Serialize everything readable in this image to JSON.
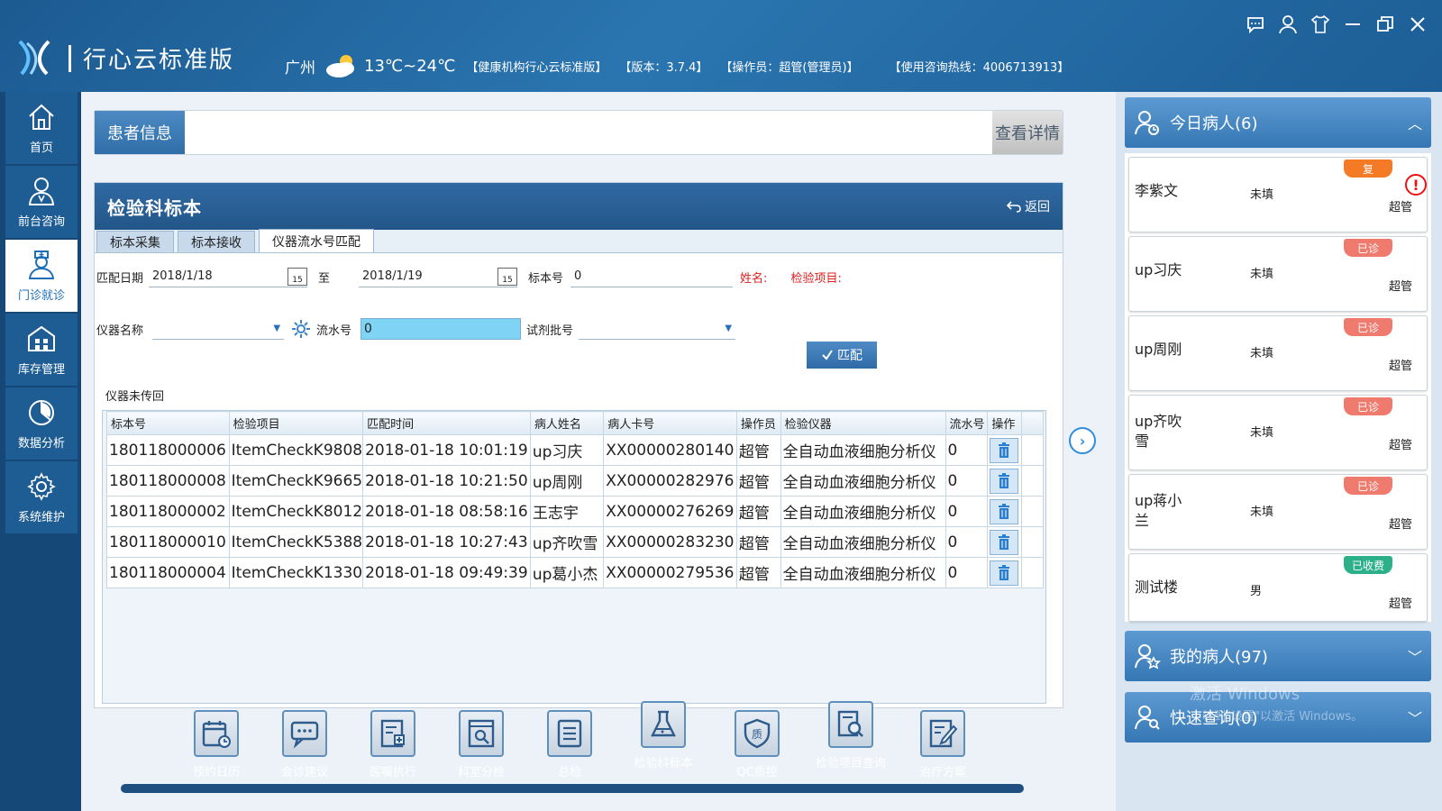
{
  "header": {
    "app_title": "行心云标准版",
    "city": "广州",
    "temperature": "13℃~24℃",
    "org": "【健康机构行心云标准版】",
    "version": "【版本：3.7.4】",
    "operator": "【操作员：超管(管理员)】",
    "hotline": "【使用咨询热线：4006713913】"
  },
  "sidebar": {
    "items": [
      {
        "label": "首页",
        "icon": "home-icon"
      },
      {
        "label": "前台咨询",
        "icon": "consult-icon"
      },
      {
        "label": "门诊就诊",
        "icon": "doctor-icon"
      },
      {
        "label": "库存管理",
        "icon": "warehouse-icon"
      },
      {
        "label": "数据分析",
        "icon": "chart-icon"
      },
      {
        "label": "系统维护",
        "icon": "gear-icon"
      }
    ]
  },
  "patient_bar": {
    "label": "患者信息",
    "detail_button": "查看详情"
  },
  "panel": {
    "title": "检验科标本",
    "back": "返回",
    "tabs": [
      "标本采集",
      "标本接收",
      "仪器流水号匹配"
    ],
    "form": {
      "match_date_label": "匹配日期",
      "date_from": "2018/1/18",
      "to_label": "至",
      "date_to": "2018/1/19",
      "specimen_no_label": "标本号",
      "specimen_no": "0",
      "name_label": "姓名:",
      "item_label": "检验项目:",
      "instrument_label": "仪器名称",
      "flow_no_label": "流水号",
      "flow_no": "0",
      "batch_label": "试剂批号",
      "match_button": "匹配",
      "calendar_day": "15"
    },
    "group_label": "仪器未传回",
    "table": {
      "columns": [
        "标本号",
        "检验项目",
        "匹配时间",
        "病人姓名",
        "病人卡号",
        "操作员",
        "检验仪器",
        "流水号",
        "操作"
      ],
      "rows": [
        [
          "180118000006",
          "ItemCheckK9808",
          "2018-01-18 10:01:19",
          "up习庆",
          "XX00000280140",
          "超管",
          "全自动血液细胞分析仪",
          "0"
        ],
        [
          "180118000008",
          "ItemCheckK9665",
          "2018-01-18 10:21:50",
          "up周刚",
          "XX00000282976",
          "超管",
          "全自动血液细胞分析仪",
          "0"
        ],
        [
          "180118000002",
          "ItemCheckK8012",
          "2018-01-18 08:58:16",
          "王志宇",
          "XX00000276269",
          "超管",
          "全自动血液细胞分析仪",
          "0"
        ],
        [
          "180118000010",
          "ItemCheckK5388",
          "2018-01-18 10:27:43",
          "up齐吹雪",
          "XX00000283230",
          "超管",
          "全自动血液细胞分析仪",
          "0"
        ],
        [
          "180118000004",
          "ItemCheckK1330",
          "2018-01-18 09:49:39",
          "up葛小杰",
          "XX00000279536",
          "超管",
          "全自动血液细胞分析仪",
          "0"
        ]
      ]
    }
  },
  "tools": [
    {
      "label": "预约日历",
      "icon": "calendar-icon"
    },
    {
      "label": "会诊建议",
      "icon": "chat-icon"
    },
    {
      "label": "医嘱执行",
      "icon": "order-icon"
    },
    {
      "label": "科室分检",
      "icon": "dept-icon"
    },
    {
      "label": "总检",
      "icon": "list-icon"
    },
    {
      "label": "检验科标本",
      "icon": "flask-icon"
    },
    {
      "label": "QC质控",
      "icon": "shield-icon"
    },
    {
      "label": "检验项目查询",
      "icon": "search-doc-icon"
    },
    {
      "label": "治疗方案",
      "icon": "edit-doc-icon"
    }
  ],
  "right_panel": {
    "today_title": "今日病人(6)",
    "patients": [
      {
        "name": "李紫文",
        "gender": "未填",
        "operator": "超管",
        "badge": "复",
        "badge_type": "fu",
        "alert": "!"
      },
      {
        "name": "up习庆",
        "gender": "未填",
        "operator": "超管",
        "badge": "已诊",
        "badge_type": "yz"
      },
      {
        "name": "up周刚",
        "gender": "未填",
        "operator": "超管",
        "badge": "已诊",
        "badge_type": "yz"
      },
      {
        "name": "up齐吹雪",
        "gender": "未填",
        "operator": "超管",
        "badge": "已诊",
        "badge_type": "yz"
      },
      {
        "name": "up蒋小兰",
        "gender": "未填",
        "operator": "超管",
        "badge": "已诊",
        "badge_type": "yz"
      },
      {
        "name": "测试楼",
        "gender": "男",
        "operator": "超管",
        "badge": "已收费",
        "badge_type": "ysf"
      }
    ],
    "my_title": "我的病人(97)",
    "quick_title": "快速查询(0)",
    "watermark_1": "激活 Windows",
    "watermark_2": "转到\"设置\"以激活 Windows。"
  },
  "colors": {
    "header_bg": "#2a75b0",
    "accent": "#2f6aa3",
    "flow_input_bg": "#7fd3f5",
    "badge_fu": "#f47a26",
    "badge_yz": "#ef7b6f",
    "badge_ysf": "#2cb08a",
    "red_label": "#e02020"
  }
}
